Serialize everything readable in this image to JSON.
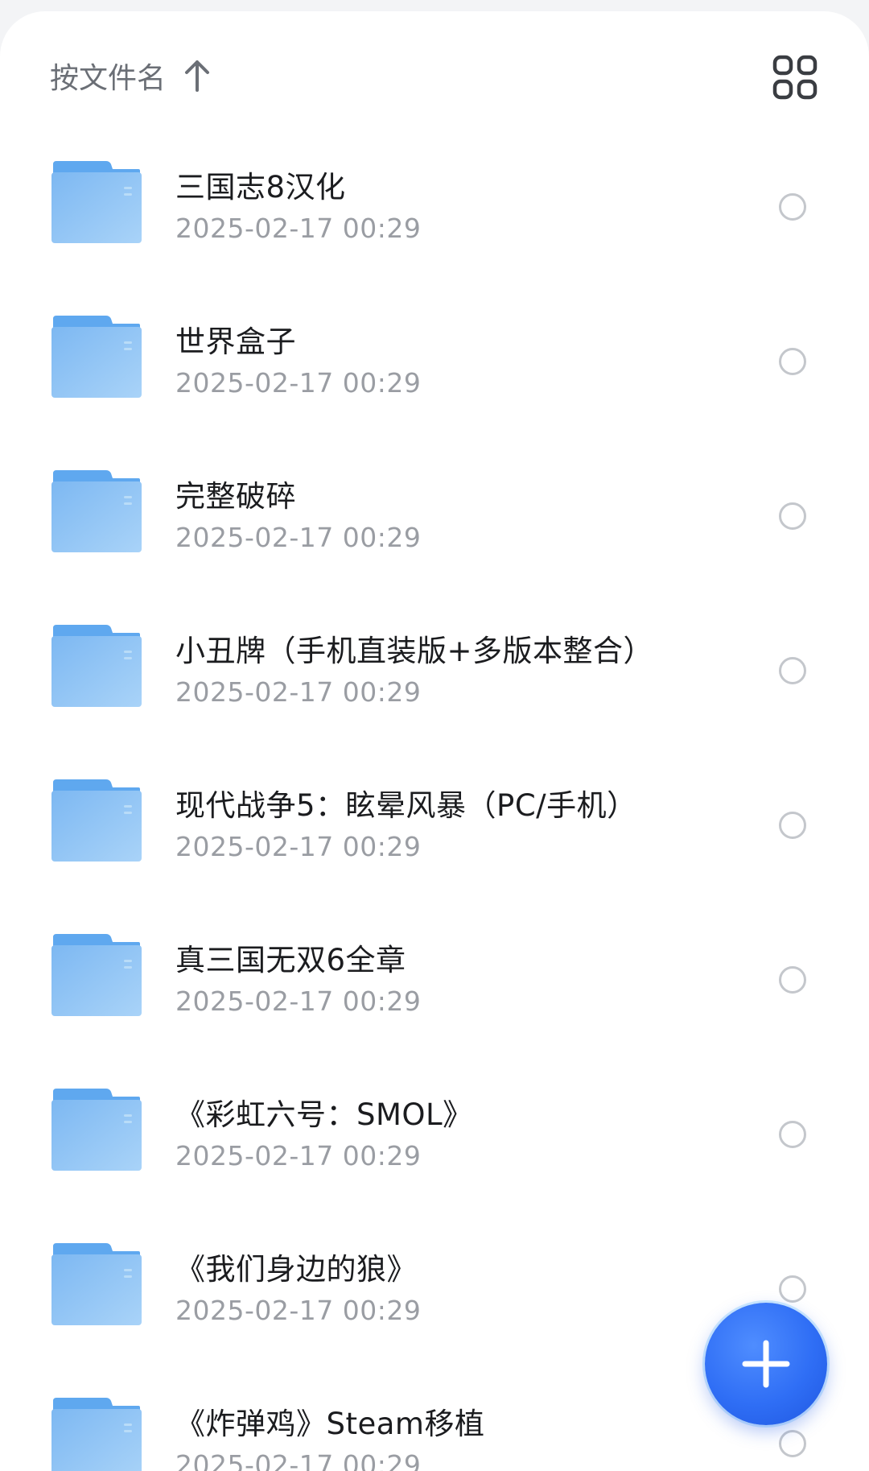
{
  "header": {
    "sort_label": "按文件名",
    "sort_icon": "arrow-up-icon",
    "view_icon": "grid-view-icon"
  },
  "files": [
    {
      "name": "三国志8汉化",
      "date": "2025-02-17 00:29"
    },
    {
      "name": "世界盒子",
      "date": "2025-02-17 00:29"
    },
    {
      "name": "完整破碎",
      "date": "2025-02-17 00:29"
    },
    {
      "name": "小丑牌（手机直装版+多版本整合）",
      "date": "2025-02-17 00:29"
    },
    {
      "name": "现代战争5：眩晕风暴（PC/手机）",
      "date": "2025-02-17 00:29"
    },
    {
      "name": "真三国无双6全章",
      "date": "2025-02-17 00:29"
    },
    {
      "name": "《彩虹六号：SMOL》",
      "date": "2025-02-17 00:29"
    },
    {
      "name": "《我们身边的狼》",
      "date": "2025-02-17 00:29"
    },
    {
      "name": "《炸弹鸡》Steam移植",
      "date": "2025-02-17 00:29"
    }
  ],
  "fab": {
    "icon": "plus-icon"
  },
  "colors": {
    "accent": "#2f6ef5",
    "folder": "#8cc3f4",
    "text_primary": "#1b1c1f",
    "text_secondary": "#9a9da3"
  }
}
